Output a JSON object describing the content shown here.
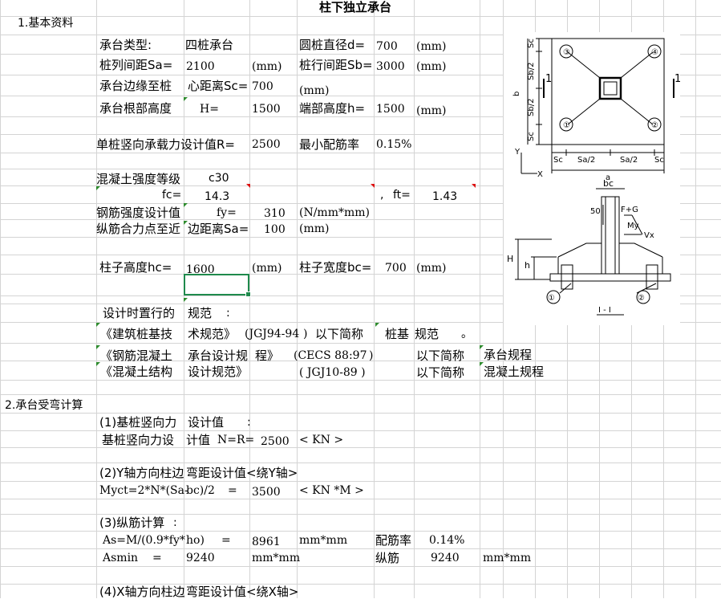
{
  "title": "柱下独立承台",
  "sec1": "1.基本资料",
  "r1": {
    "c1": "承台类型:",
    "c2": "四桩承台",
    "c3": "圆桩直径d=",
    "c4": "700",
    "c5": "(mm)"
  },
  "r2": {
    "c1": "桩列间距Sa=",
    "c2": "2100",
    "c3": "(mm)",
    "c4": "桩行间距Sb=",
    "c5": "3000",
    "c6": "(mm)"
  },
  "r3": {
    "c1": "承台边缘至桩",
    "c2": "心距离Sc=",
    "c3": "700",
    "c4": "(mm)"
  },
  "r4": {
    "c1": "承台根部高度",
    "c2": "H=",
    "c3": "1500",
    "c4": "端部高度h=",
    "c5": "1500",
    "c6": "(mm)"
  },
  "r5": {
    "c1": "单桩竖向承载力设计值R=",
    "c2": "2500",
    "c3": "最小配筋率",
    "c4": "0.15%"
  },
  "r6": {
    "c1": "混凝土强度等级",
    "c2": "c30"
  },
  "r7": {
    "c1": "fc=",
    "c2": "14.3",
    "c3": ",",
    "c4": "ft=",
    "c5": "1.43"
  },
  "r8": {
    "c1": "钢筋强度设计值",
    "c2": "fy=",
    "c3": "310",
    "c4": "(N/mm*mm)"
  },
  "r9": {
    "c1": "纵筋合力点至近",
    "c2": "边距离Sa=",
    "c3": "100",
    "c4": "(mm)"
  },
  "r10": {
    "c1": "柱子高度hc=",
    "c2": "1600",
    "c3": "(mm)",
    "c4": "柱子宽度bc=",
    "c5": "700",
    "c6": "(mm)"
  },
  "r11": {
    "c1": "设计时置行的",
    "c2": "规范",
    "c3": ":"
  },
  "r12": {
    "c1": "《建筑桩基技",
    "c2": "术规范》",
    "c3": "(JGJ94-94",
    "c4": ")",
    "c5": "以下简称",
    "c6": "桩基",
    "c7": "规范",
    "c8": "。"
  },
  "r13": {
    "c1": "《钢筋混凝土",
    "c2": "承台设计规",
    "c3": "程》",
    "c4": "(CECS 88:97",
    "c5": ")",
    "c6": "以下简称",
    "c7": "承台规程"
  },
  "r14": {
    "c1": "《混凝土结构",
    "c2": "设计规范》",
    "c3": "( JGJ10-89 )",
    "c4": "以下简称",
    "c5": "混凝土规程"
  },
  "sec2": "2.承台受弯计算",
  "r15": {
    "c1": "(1)基桩竖向力",
    "c2": "设计值",
    "c3": ":"
  },
  "r16": {
    "c1": "基桩竖向力设",
    "c2": "计值",
    "c3": "N=R=",
    "c4": "2500",
    "c5": "< KN >"
  },
  "r17": {
    "c1": "(2)Y轴方向柱边",
    "c2": "弯距设计值<绕Y轴>"
  },
  "r18": {
    "c1": "Myct=2*N*(Sa-",
    "c2": "bc)/2",
    "c3": "=",
    "c4": "3500",
    "c5": "< KN *M >"
  },
  "r19": {
    "c1": "(3)纵筋计算",
    "c2": ":"
  },
  "r20": {
    "c1": "As=M/(0.9*fy*",
    "c2": "ho)",
    "c3": "=",
    "c4": "8961",
    "c5": "mm*mm",
    "c6": "配筋率",
    "c7": "0.14%"
  },
  "r21": {
    "c1": "Asmin",
    "c2": "=",
    "c3": "9240",
    "c4": "mm*mm",
    "c5": "纵筋",
    "c6": "9240",
    "c7": "mm*mm"
  },
  "r22": {
    "c1": "(4)X轴方向柱边",
    "c2": "弯距设计值<绕X轴>"
  },
  "figure": {
    "pile_labels": [
      "③",
      "④",
      "①",
      "②"
    ],
    "sc": "Sc",
    "sb2": "Sb/2",
    "sa2": "Sa/2",
    "b": "b",
    "a": "a",
    "sec1": "1",
    "y": "Y",
    "x": "X",
    "bc": "bc",
    "fg": "F+G",
    "my": "My",
    "vx": "Vx",
    "h50": "50",
    "H": "H",
    "h": "h",
    "c1": "①",
    "c2": "②",
    "section": "Ⅰ - Ⅰ"
  }
}
